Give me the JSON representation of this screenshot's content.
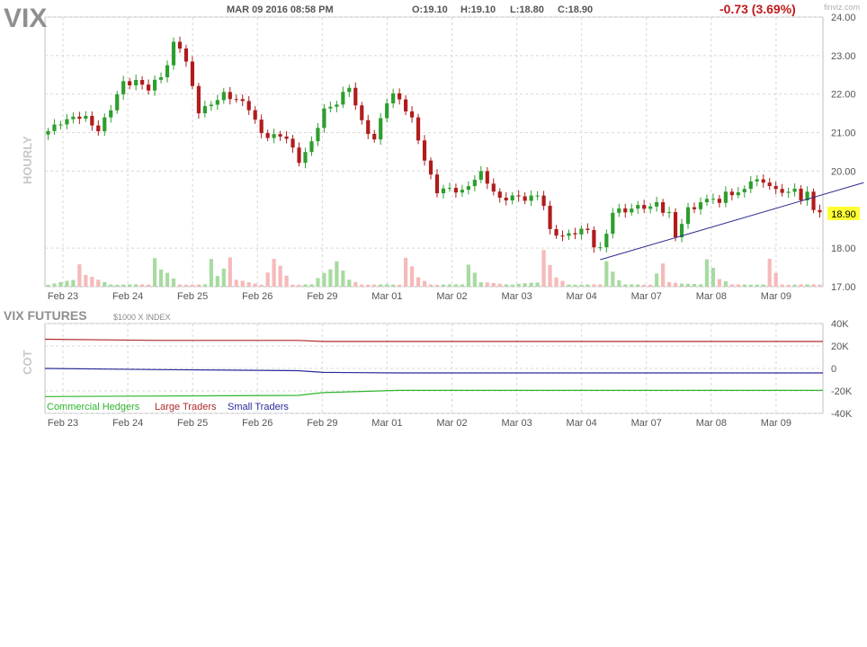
{
  "header": {
    "symbol": "VIX",
    "datetime": "MAR 09 2016 08:58 PM",
    "open": "O:19.10",
    "high": "H:19.10",
    "low": "L:18.80",
    "close": "C:18.90",
    "change": "-0.73 (3.69%)",
    "watermark": "finviz.com"
  },
  "colors": {
    "up": "#2e9e2e",
    "down": "#b01c1c",
    "up_volume": "#a7dba0",
    "down_volume": "#f6b9b9",
    "grid": "#d8d8d8",
    "trendline": "#2a2a8c",
    "last_price_bg": "#ffff33",
    "change_text": "#c01a1a",
    "commercial": "#2db52d",
    "large": "#b02a2a",
    "small": "#2a2a9a"
  },
  "chart_data": [
    {
      "type": "candlestick",
      "title": "VIX",
      "ylabel": "HOURLY",
      "ylim": [
        17.0,
        24.0
      ],
      "y_ticks": [
        "24.00",
        "23.00",
        "22.00",
        "21.00",
        "20.00",
        "18.00",
        "17.00"
      ],
      "x_labels": [
        "Feb 23",
        "Feb 24",
        "Feb 25",
        "Feb 26",
        "Feb 29",
        "Mar 01",
        "Mar 02",
        "Mar 03",
        "Mar 04",
        "Mar 07",
        "Mar 08",
        "Mar 09"
      ],
      "last_price": "18.90",
      "close_path": [
        [
          0,
          21.0
        ],
        [
          2,
          21.3
        ],
        [
          4,
          21.4
        ],
        [
          6,
          21.35
        ],
        [
          8,
          21.1
        ],
        [
          10,
          21.6
        ],
        [
          12,
          22.3
        ],
        [
          14,
          22.35
        ],
        [
          16,
          22.1
        ],
        [
          18,
          22.5
        ],
        [
          19,
          22.8
        ],
        [
          20,
          23.3
        ],
        [
          21,
          23.2
        ],
        [
          22,
          22.8
        ],
        [
          24,
          21.6
        ],
        [
          26,
          21.7
        ],
        [
          28,
          22.0
        ],
        [
          30,
          21.9
        ],
        [
          32,
          21.6
        ],
        [
          34,
          21.0
        ],
        [
          36,
          20.9
        ],
        [
          38,
          20.85
        ],
        [
          40,
          20.3
        ],
        [
          42,
          20.7
        ],
        [
          44,
          21.6
        ],
        [
          46,
          21.8
        ],
        [
          48,
          22.15
        ],
        [
          50,
          21.3
        ],
        [
          52,
          20.8
        ],
        [
          54,
          21.8
        ],
        [
          55,
          22.0
        ],
        [
          56,
          21.9
        ],
        [
          58,
          21.3
        ],
        [
          60,
          20.3
        ],
        [
          62,
          19.5
        ],
        [
          64,
          19.5
        ],
        [
          66,
          19.5
        ],
        [
          68,
          19.8
        ],
        [
          69,
          19.9
        ],
        [
          70,
          19.7
        ],
        [
          72,
          19.3
        ],
        [
          74,
          19.3
        ],
        [
          76,
          19.3
        ],
        [
          78,
          19.4
        ],
        [
          79,
          19.1
        ],
        [
          80,
          18.4
        ],
        [
          82,
          18.35
        ],
        [
          84,
          18.4
        ],
        [
          86,
          18.45
        ],
        [
          87,
          18.1
        ],
        [
          88,
          18.0
        ],
        [
          89,
          18.4
        ],
        [
          90,
          18.9
        ],
        [
          92,
          19.0
        ],
        [
          94,
          19.1
        ],
        [
          96,
          19.0
        ],
        [
          97,
          19.2
        ],
        [
          98,
          19.0
        ],
        [
          99,
          18.9
        ],
        [
          100,
          18.3
        ],
        [
          101,
          18.6
        ],
        [
          102,
          19.0
        ],
        [
          104,
          19.2
        ],
        [
          106,
          19.3
        ],
        [
          107,
          19.1
        ],
        [
          108,
          19.5
        ],
        [
          110,
          19.4
        ],
        [
          112,
          19.7
        ],
        [
          114,
          19.8
        ],
        [
          115,
          19.6
        ],
        [
          116,
          19.5
        ],
        [
          118,
          19.4
        ],
        [
          119,
          19.6
        ],
        [
          120,
          19.3
        ],
        [
          121,
          19.4
        ],
        [
          122,
          19.0
        ],
        [
          123,
          18.9
        ]
      ],
      "volume_path": [
        [
          0,
          0.05
        ],
        [
          4,
          0.15
        ],
        [
          5,
          0.55
        ],
        [
          6,
          0.3
        ],
        [
          8,
          0.15
        ],
        [
          10,
          0.05
        ],
        [
          14,
          0.05
        ],
        [
          16,
          0.05
        ],
        [
          17,
          0.75
        ],
        [
          18,
          0.4
        ],
        [
          19,
          0.3
        ],
        [
          21,
          0.05
        ],
        [
          25,
          0.05
        ],
        [
          26,
          0.6
        ],
        [
          27,
          0.25
        ],
        [
          29,
          0.7
        ],
        [
          30,
          0.15
        ],
        [
          34,
          0.05
        ],
        [
          36,
          0.6
        ],
        [
          37,
          0.45
        ],
        [
          39,
          0.05
        ],
        [
          42,
          0.05
        ],
        [
          46,
          0.6
        ],
        [
          47,
          0.35
        ],
        [
          48,
          0.15
        ],
        [
          50,
          0.05
        ],
        [
          56,
          0.05
        ],
        [
          57,
          0.7
        ],
        [
          58,
          0.45
        ],
        [
          59,
          0.2
        ],
        [
          61,
          0.05
        ],
        [
          66,
          0.05
        ],
        [
          67,
          0.55
        ],
        [
          68,
          0.35
        ],
        [
          69,
          0.1
        ],
        [
          74,
          0.05
        ],
        [
          78,
          0.1
        ],
        [
          79,
          0.95
        ],
        [
          80,
          0.5
        ],
        [
          81,
          0.2
        ],
        [
          83,
          0.05
        ],
        [
          88,
          0.05
        ],
        [
          89,
          0.6
        ],
        [
          90,
          0.4
        ],
        [
          91,
          0.15
        ],
        [
          92,
          0.05
        ],
        [
          96,
          0.05
        ],
        [
          97,
          0.3
        ],
        [
          98,
          0.5
        ],
        [
          99,
          0.1
        ],
        [
          104,
          0.05
        ],
        [
          105,
          0.6
        ],
        [
          106,
          0.45
        ],
        [
          107,
          0.2
        ],
        [
          109,
          0.05
        ],
        [
          114,
          0.05
        ],
        [
          115,
          0.6
        ],
        [
          116,
          0.3
        ],
        [
          117,
          0.05
        ],
        [
          123,
          0.05
        ]
      ],
      "trendline": {
        "from": [
          88,
          17.7
        ],
        "to": [
          130,
          19.7
        ]
      }
    },
    {
      "type": "line",
      "title": "VIX FUTURES",
      "subtitle": "$1000 X INDEX",
      "ylabel": "COT",
      "ylim": [
        -40000,
        40000
      ],
      "y_ticks": [
        "40K",
        "20K",
        "0",
        "-20K",
        "-40K"
      ],
      "x_labels": [
        "Feb 23",
        "Feb 24",
        "Feb 25",
        "Feb 26",
        "Feb 29",
        "Mar 01",
        "Mar 02",
        "Mar 03",
        "Mar 04",
        "Mar 07",
        "Mar 08",
        "Mar 09"
      ],
      "series": [
        {
          "name": "Commercial Hedgers",
          "color": "#2db52d",
          "points": [
            [
              0,
              -25000
            ],
            [
              40,
              -24000
            ],
            [
              44,
              -21500
            ],
            [
              56,
              -19500
            ],
            [
              123,
              -19500
            ]
          ]
        },
        {
          "name": "Large Traders",
          "color": "#b02a2a",
          "points": [
            [
              0,
              26000
            ],
            [
              18,
              25000
            ],
            [
              40,
              25000
            ],
            [
              44,
              24000
            ],
            [
              123,
              24000
            ]
          ]
        },
        {
          "name": "Small Traders",
          "color": "#2a2a9a",
          "points": [
            [
              0,
              0
            ],
            [
              18,
              -1000
            ],
            [
              40,
              -2000
            ],
            [
              44,
              -3500
            ],
            [
              56,
              -4000
            ],
            [
              123,
              -4000
            ]
          ]
        }
      ]
    }
  ]
}
